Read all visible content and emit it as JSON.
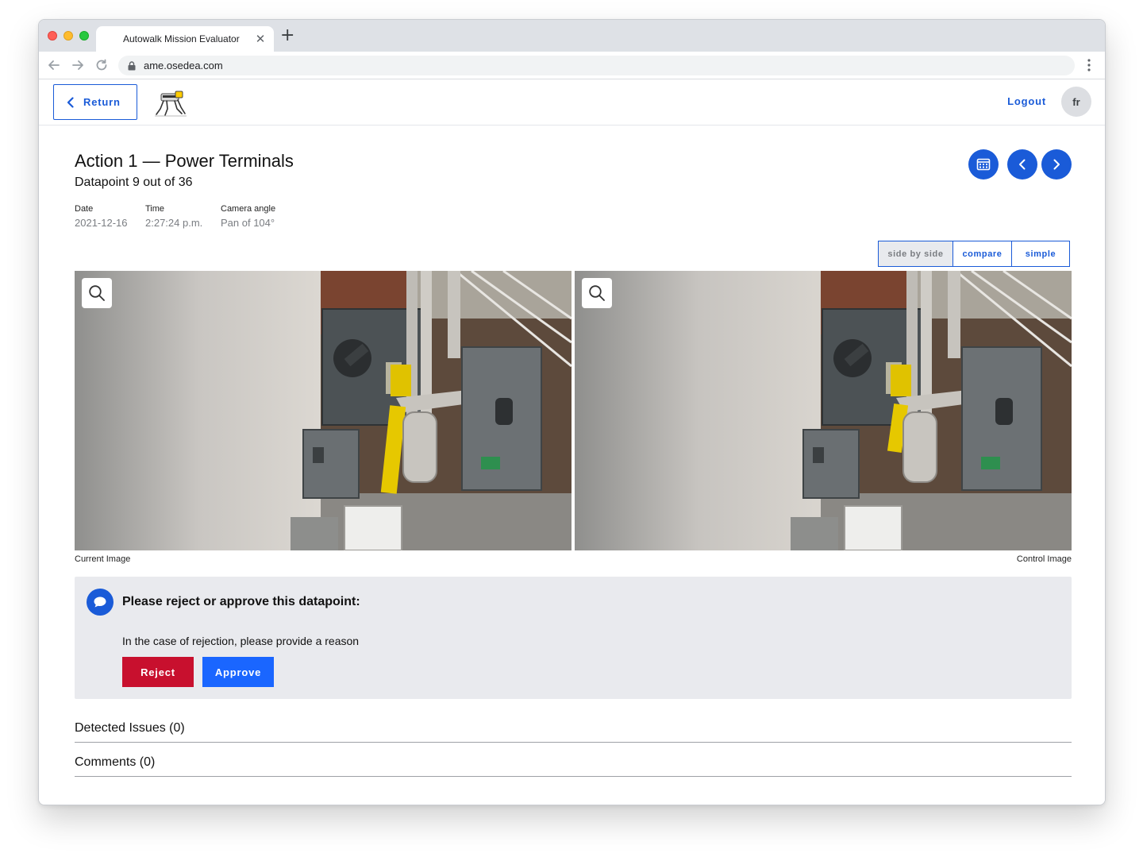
{
  "browser": {
    "tab_title": "Autowalk Mission Evaluator",
    "tab_close": "✕",
    "new_tab": "+",
    "url": "ame.osedea.com"
  },
  "header": {
    "return_label": "Return",
    "logout_label": "Logout",
    "avatar_initials": "fr"
  },
  "datapoint": {
    "title": "Action 1 — Power Terminals",
    "subtitle": "Datapoint 9 out of 36",
    "meta": [
      {
        "label": "Date",
        "value": "2021-12-16"
      },
      {
        "label": "Time",
        "value": "2:27:24 p.m."
      },
      {
        "label": "Camera angle",
        "value": "Pan of 104°"
      }
    ]
  },
  "nav_icons": [
    "calendar-icon",
    "chevron-left-icon",
    "chevron-right-icon"
  ],
  "view_modes": {
    "options": [
      "side by side",
      "compare",
      "simple"
    ],
    "selected": "side by side"
  },
  "images": {
    "current_caption": "Current Image",
    "control_caption": "Control Image"
  },
  "decision": {
    "title": "Please reject or approve this datapoint:",
    "hint": "In the case of rejection, please provide a reason",
    "reject_label": "Reject",
    "approve_label": "Approve"
  },
  "sections": {
    "issues": "Detected Issues (0)",
    "comments": "Comments (0)"
  },
  "colors": {
    "primary": "#1a5bd8",
    "approve": "#1a66ff",
    "reject": "#c8102e",
    "panel_bg": "#e9eaee"
  }
}
